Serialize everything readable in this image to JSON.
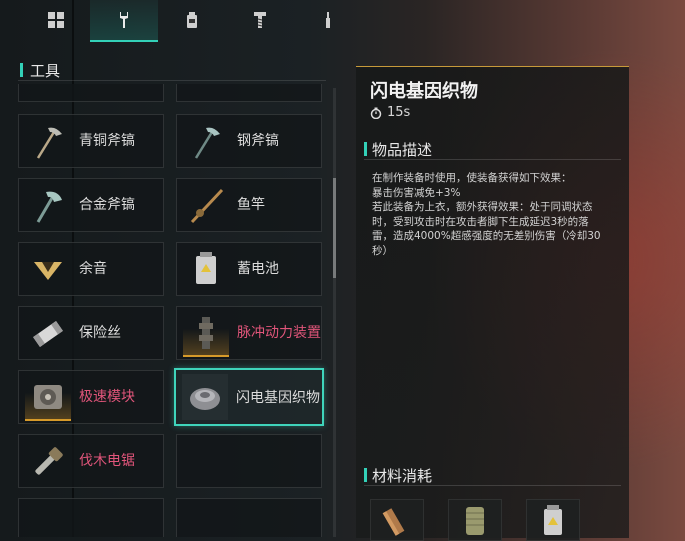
{
  "tabs": [
    {
      "icon": "grid-icon",
      "active": false
    },
    {
      "icon": "wrench-icon",
      "active": true
    },
    {
      "icon": "bottle-icon",
      "active": false
    },
    {
      "icon": "screw-icon",
      "active": false
    },
    {
      "icon": "stick-icon",
      "active": false
    }
  ],
  "section_title": "工具",
  "items": [
    {
      "label": "青铜斧镐",
      "icon": "bronze-axe-pick-icon",
      "locked": false
    },
    {
      "label": "钢斧镐",
      "icon": "steel-axe-pick-icon",
      "locked": false
    },
    {
      "label": "合金斧镐",
      "icon": "alloy-axe-pick-icon",
      "locked": false
    },
    {
      "label": "鱼竿",
      "icon": "fishing-rod-icon",
      "locked": false
    },
    {
      "label": "余音",
      "icon": "echo-icon",
      "locked": false
    },
    {
      "label": "蓄电池",
      "icon": "battery-icon",
      "locked": false
    },
    {
      "label": "保险丝",
      "icon": "fuse-icon",
      "locked": false
    },
    {
      "label": "脉冲动力装置",
      "icon": "pulse-device-icon",
      "locked": true
    },
    {
      "label": "极速模块",
      "icon": "speed-module-icon",
      "locked": true
    },
    {
      "label": "闪电基因织物",
      "icon": "lightning-fabric-icon",
      "locked": false,
      "selected": true
    },
    {
      "label": "伐木电锯",
      "icon": "chainsaw-icon",
      "locked": true
    },
    {
      "label": "",
      "icon": "",
      "locked": false
    }
  ],
  "detail": {
    "title": "闪电基因织物",
    "time": "15s",
    "desc_header": "物品描述",
    "desc_lines": [
      "在制作装备时使用，使装备获得如下效果：",
      "暴击伤害减免+3%",
      "若此装备为上衣，额外获得效果：处于同调状态",
      "时，受到攻击时在攻击者脚下生成延迟3秒的落",
      "雷，造成4000%超感强度的无差别伤害（冷却30",
      "秒）"
    ],
    "materials_header": "材料消耗",
    "materials": [
      {
        "icon": "copper-bar-icon"
      },
      {
        "icon": "coil-icon"
      },
      {
        "icon": "battery-icon"
      }
    ]
  },
  "colors": {
    "accent": "#33d1b8",
    "locked": "#e0557a",
    "gold": "#d69a2a"
  }
}
